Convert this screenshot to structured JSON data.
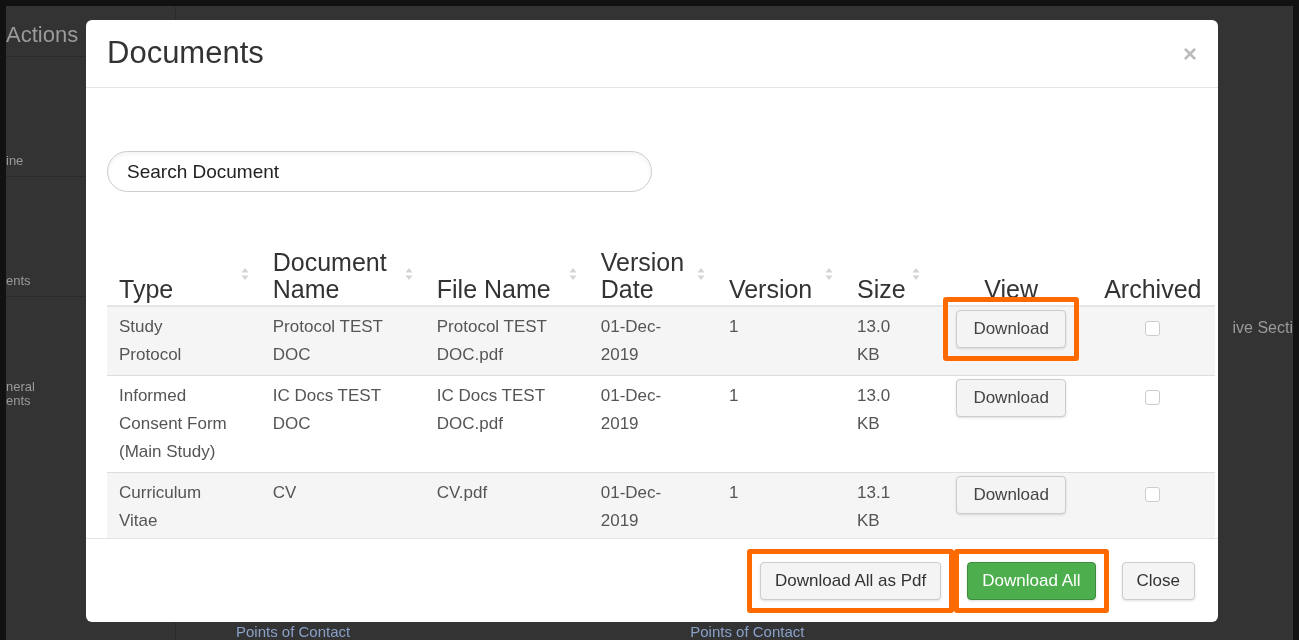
{
  "background": {
    "sidebar_heading": "Actions",
    "sidebar_items": [
      "ine",
      "ents",
      "neral\nents"
    ],
    "right_label": "ive Secti",
    "footer_links": [
      "Points of Contact",
      "Points of Contact"
    ]
  },
  "dialog": {
    "title": "Documents",
    "close": "×",
    "search": {
      "placeholder": "Search Document"
    },
    "columns": [
      {
        "label": "Type",
        "sortable": true
      },
      {
        "label": "Document\nName",
        "sortable": true
      },
      {
        "label": "File Name",
        "sortable": true
      },
      {
        "label": "Version\nDate",
        "sortable": true
      },
      {
        "label": "Version",
        "sortable": true
      },
      {
        "label": "Size",
        "sortable": true
      },
      {
        "label": "View",
        "sortable": false
      },
      {
        "label": "Archived",
        "sortable": false
      }
    ],
    "rows": [
      {
        "type": "Study\nProtocol",
        "document_name": "Protocol TEST\nDOC",
        "file_name": "Protocol TEST\nDOC.pdf",
        "version_date": "01-Dec-\n2019",
        "version": "1",
        "size": "13.0\nKB",
        "view": {
          "label": "Download",
          "highlighted": true
        },
        "archived": false
      },
      {
        "type": "Informed\nConsent Form\n(Main Study)",
        "document_name": "IC Docs TEST\nDOC",
        "file_name": "IC Docs TEST\nDOC.pdf",
        "version_date": "01-Dec-\n2019",
        "version": "1",
        "size": "13.0\nKB",
        "view": {
          "label": "Download",
          "highlighted": false
        },
        "archived": false
      },
      {
        "type": "Curriculum\nVitae",
        "document_name": "CV",
        "file_name": "CV.pdf",
        "version_date": "01-Dec-\n2019",
        "version": "1",
        "size": "13.1\nKB",
        "view": {
          "label": "Download",
          "highlighted": false
        },
        "archived": false
      }
    ],
    "buttons": [
      {
        "label": "Download All as Pdf",
        "kind": "default",
        "highlighted": true
      },
      {
        "label": "Download All",
        "kind": "primary",
        "highlighted": true
      },
      {
        "label": "Close",
        "kind": "default",
        "highlighted": false
      }
    ]
  }
}
